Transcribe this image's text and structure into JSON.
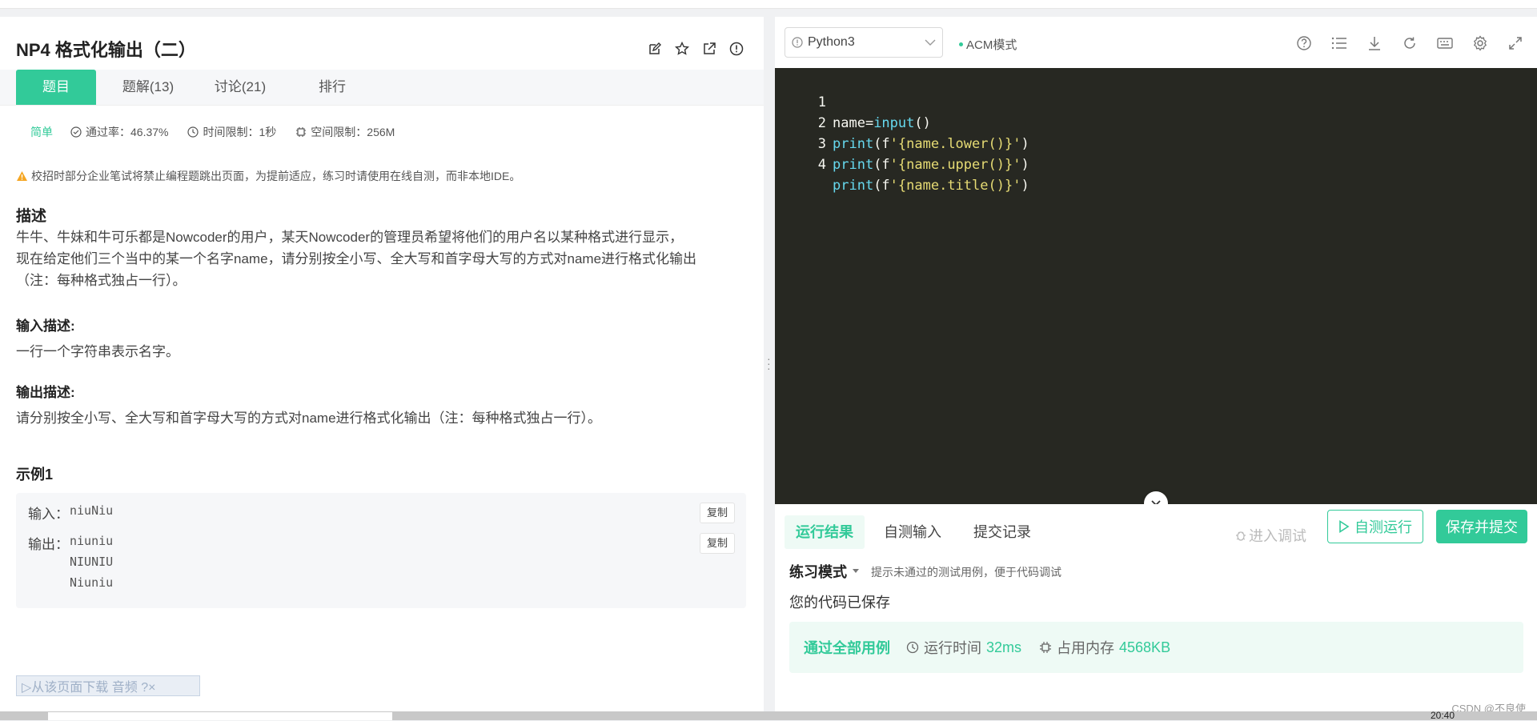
{
  "problem": {
    "title": "NP4  格式化输出（二）",
    "tabs": [
      "题目",
      "题解(13)",
      "讨论(21)",
      "排行"
    ],
    "difficulty": "简单",
    "pass_rate": "通过率：46.37%",
    "time_limit": "时间限制：1秒",
    "space_limit": "空间限制：256M",
    "warning": "校招时部分企业笔试将禁止编程题跳出页面，为提前适应，练习时请使用在线自测，而非本地IDE。",
    "desc_heading": "描述",
    "desc_lines": [
      "牛牛、牛妹和牛可乐都是Nowcoder的用户，某天Nowcoder的管理员希望将他们的用户名以某种格式进行显示，",
      "现在给定他们三个当中的某一个名字name，请分别按全小写、全大写和首字母大写的方式对name进行格式化输出",
      "（注：每种格式独占一行）。"
    ],
    "input_heading": "输入描述:",
    "input_desc": "一行一个字符串表示名字。",
    "output_heading": "输出描述:",
    "output_desc": "请分别按全小写、全大写和首字母大写的方式对name进行格式化输出（注：每种格式独占一行）。",
    "example_heading": "示例1",
    "example": {
      "input_label": "输入：",
      "input_value": "niuNiu",
      "output_label": "输出：",
      "output_value": "niuniu\nNIUNIU\nNiuniu",
      "copy_label": "复制"
    },
    "audio_bar": "▷从该页面下载 音频 ?×"
  },
  "editor": {
    "language": "Python3",
    "mode": "ACM模式",
    "line_numbers": [
      "1",
      "2",
      "3",
      "4"
    ],
    "code_lines": [
      "name=input()",
      "print(f'{name.lower()}')",
      "print(f'{name.upper()}')",
      "print(f'{name.title()}')"
    ],
    "colors": {
      "background": "#272822",
      "keyword": "#66d9ef",
      "string": "#e6db74",
      "method": "#a6e22e"
    }
  },
  "results": {
    "tabs": [
      "运行结果",
      "自测输入",
      "提交记录"
    ],
    "debug_label": "进入调试",
    "run_label": "自测运行",
    "submit_label": "保存并提交",
    "mode_label": "练习模式",
    "mode_tip": "提示未通过的测试用例，便于代码调试",
    "saved_text": "您的代码已保存",
    "pass_text": "通过全部用例",
    "runtime_label": "运行时间",
    "runtime_value": "32ms",
    "memory_label": "占用内存",
    "memory_value": "4568KB"
  },
  "watermark": "CSDN @不良使",
  "taskbar_time": "20:40",
  "accent_color": "#32ca99"
}
